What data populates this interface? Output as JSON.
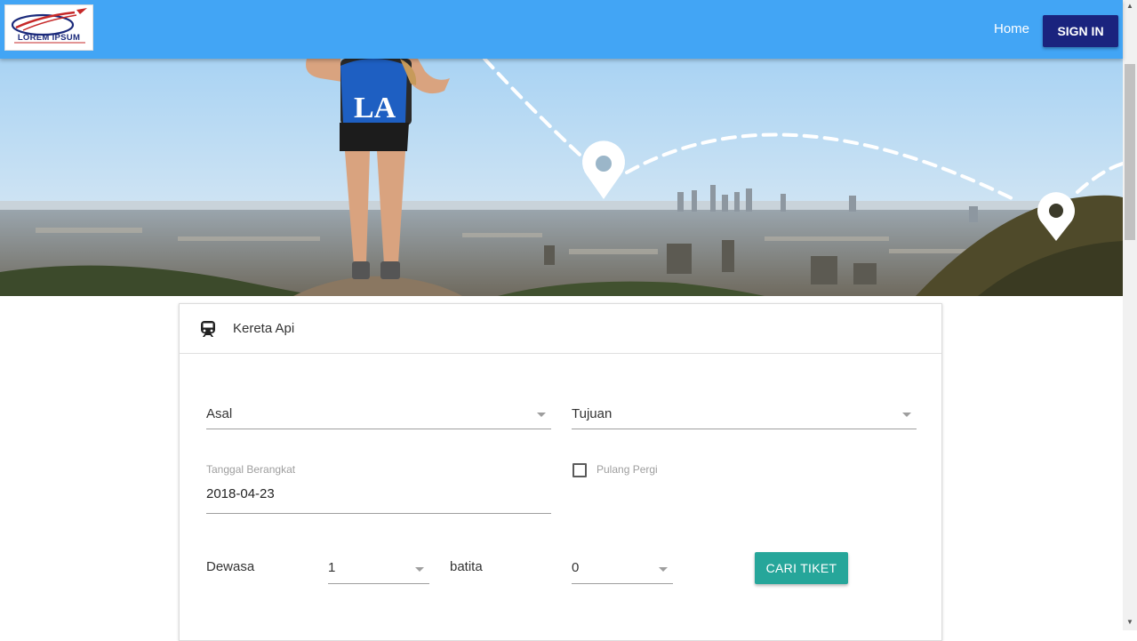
{
  "header": {
    "logo_text": "LOREM IPSUM",
    "nav_home": "Home",
    "sign_in": "SIGN IN"
  },
  "card": {
    "icon": "train-icon",
    "title": "Kereta Api",
    "asal": {
      "value": "Asal"
    },
    "tujuan": {
      "value": "Tujuan"
    },
    "tanggal_label": "Tanggal Berangkat",
    "tanggal_value": "2018-04-23",
    "pulang_pergi_label": "Pulang Pergi",
    "pulang_pergi_checked": false,
    "dewasa_label": "Dewasa",
    "dewasa_value": "1",
    "batita_label": "batita",
    "batita_value": "0",
    "search_button": "CARI TIKET"
  },
  "colors": {
    "topbar": "#42a5f5",
    "signin_button": "#1a237e",
    "search_button": "#26a69a"
  }
}
